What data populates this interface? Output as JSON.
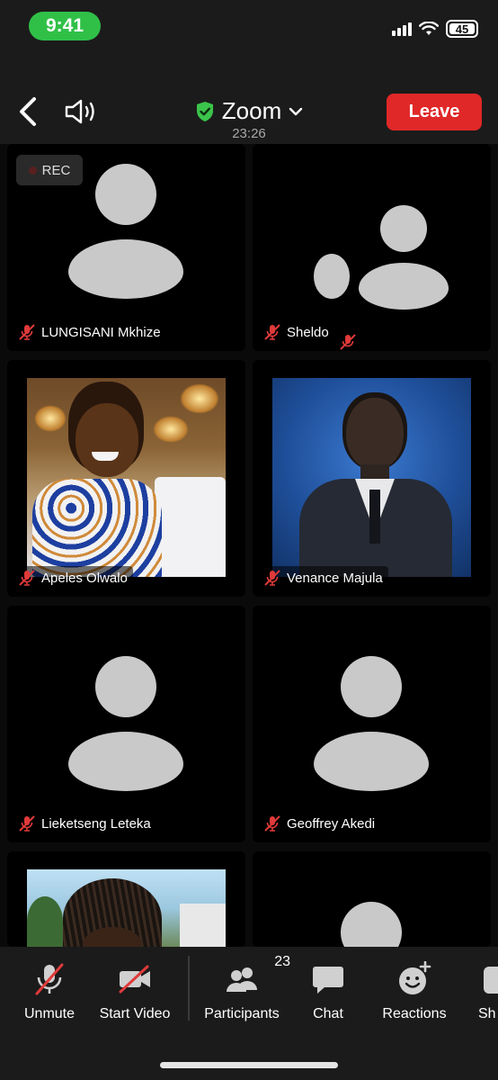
{
  "status_bar": {
    "time": "9:41",
    "battery": "45"
  },
  "header": {
    "title": "Zoom",
    "meeting_time": "23:26",
    "leave_label": "Leave"
  },
  "recording": {
    "label": "REC"
  },
  "participants": [
    {
      "name": "LUNGISANI Mkhize",
      "video": false
    },
    {
      "name": "Sheldo",
      "video": false
    },
    {
      "name": "Apeles Olwalo",
      "video": true
    },
    {
      "name": "Venance Majula",
      "video": true
    },
    {
      "name": "Lieketseng Leteka",
      "video": false
    },
    {
      "name": "Geoffrey Akedi",
      "video": false
    }
  ],
  "toolbar": {
    "unmute": "Unmute",
    "start_video": "Start Video",
    "participants": "Participants",
    "participants_count": "23",
    "chat": "Chat",
    "reactions": "Reactions",
    "share": "Sh"
  },
  "colors": {
    "leave": "#e02828",
    "status_pill": "#30c048",
    "muted_icon": "#e03a3a",
    "avatar": "#c9c9c9"
  }
}
